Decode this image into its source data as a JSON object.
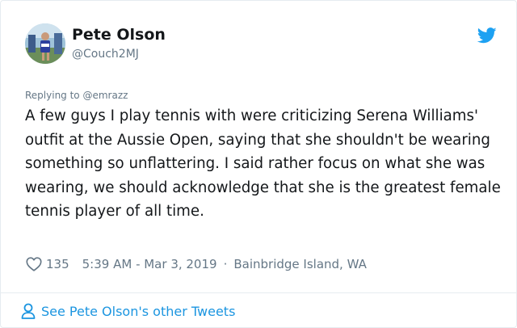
{
  "author": {
    "display_name": "Pete Olson",
    "handle": "@Couch2MJ",
    "avatar_icon": "profile-photo-runner"
  },
  "platform_icon": "twitter-bird-icon",
  "reply": {
    "text": "Replying to @emrazz"
  },
  "tweet": {
    "text": "A few guys I play tennis with were criticizing Serena Williams' outfit at the Aussie Open, saying that she shouldn't be wearing something so unflattering. I said rather focus on what she was wearing, we should acknowledge that she is the greatest female tennis player of all time."
  },
  "meta": {
    "likes": "135",
    "time": "5:39 AM - Mar 3, 2019",
    "separator": "·",
    "location": "Bainbridge Island, WA"
  },
  "footer": {
    "link_text": "See Pete Olson's other Tweets"
  },
  "colors": {
    "accent": "#1b95e0",
    "muted": "#657786",
    "text": "#14171a",
    "border": "#e6ecf0"
  }
}
